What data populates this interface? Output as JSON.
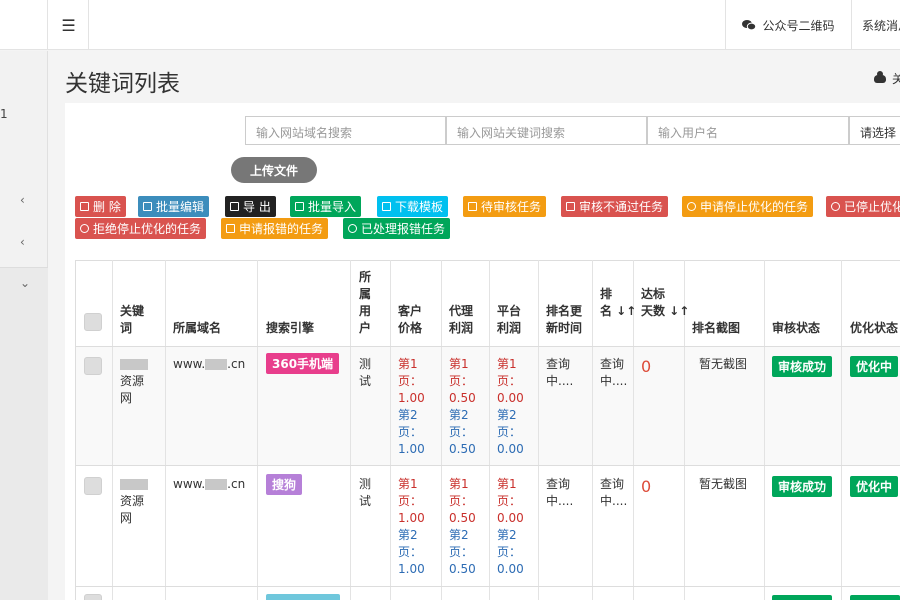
{
  "header": {
    "menu_icon": "menu-icon",
    "wechat_label": "公众号二维码",
    "wechat_icon": "wechat-icon",
    "system_label": "系统消息"
  },
  "sidebar": {
    "item_number": "1"
  },
  "page": {
    "title": "关键词列表",
    "cloud_label": "关"
  },
  "search": {
    "domain_placeholder": "输入网站域名搜索",
    "keyword_placeholder": "输入网站关键词搜索",
    "user_placeholder": "输入用户名",
    "select_placeholder": "请选择"
  },
  "upload_label": "上传文件",
  "actions": [
    {
      "label": "删 除",
      "color": "#d9534f"
    },
    {
      "label": "批量编辑",
      "color": "#3c8dbc"
    },
    {
      "label": "导 出",
      "color": "#222222"
    },
    {
      "label": "批量导入",
      "color": "#00a65a"
    },
    {
      "label": "下载模板",
      "color": "#00c0ef"
    },
    {
      "label": "待审核任务",
      "color": "#f39c12"
    },
    {
      "label": "审核不通过任务",
      "color": "#d9534f"
    },
    {
      "label": "申请停止优化的任务",
      "color": "#f39c12"
    },
    {
      "label": "已停止优化",
      "color": "#d9534f"
    },
    {
      "label": "拒绝停止优化的任务",
      "color": "#d9534f"
    },
    {
      "label": "申请报错的任务",
      "color": "#f39c12"
    },
    {
      "label": "已处理报错任务",
      "color": "#00a65a"
    }
  ],
  "table": {
    "headers": {
      "keyword": [
        "关键",
        "词"
      ],
      "domain": "所属域名",
      "engine": "搜索引擎",
      "user": [
        "所",
        "属",
        "用",
        "户"
      ],
      "client_price": [
        "客户",
        "价格"
      ],
      "agent_profit": [
        "代理",
        "利润"
      ],
      "platform_profit": [
        "平台",
        "利润"
      ],
      "rank_time": [
        "排名更",
        "新时间"
      ],
      "rank": [
        "排",
        "名 ↓↑"
      ],
      "days": [
        "达标",
        "天数 ↓↑"
      ],
      "screenshot": "排名截图",
      "review": "审核状态",
      "optimize": "优化状态"
    },
    "rows": [
      {
        "keyword": [
          "资源",
          "网"
        ],
        "domain_prefix": "www.",
        "domain_suffix": ".cn",
        "engine": "360手机端",
        "user": [
          "测",
          "试"
        ],
        "client": [
          "第1",
          "页：",
          "1.00",
          "第2",
          "页：",
          "1.00"
        ],
        "agent": [
          "第1",
          "页：",
          "0.50",
          "第2",
          "页：",
          "0.50"
        ],
        "platform": [
          "第1",
          "页：",
          "0.00",
          "第2",
          "页：",
          "0.00"
        ],
        "rank_time": [
          "查询",
          "中...."
        ],
        "rank": [
          "查询",
          "中...."
        ],
        "days": "0",
        "screenshot": "暂无截图",
        "review": "审核成功",
        "optimize": "优化中"
      },
      {
        "keyword": [
          "资源",
          "网"
        ],
        "domain_prefix": "www.",
        "domain_suffix": ".cn",
        "engine": "搜狗",
        "user": [
          "测",
          "试"
        ],
        "client": [
          "第1",
          "页：",
          "1.00",
          "第2",
          "页：",
          "1.00"
        ],
        "agent": [
          "第1",
          "页：",
          "0.50",
          "第2",
          "页：",
          "0.50"
        ],
        "platform": [
          "第1",
          "页：",
          "0.00",
          "第2",
          "页：",
          "0.00"
        ],
        "rank_time": [
          "查询",
          "中...."
        ],
        "rank": [
          "查询",
          "中...."
        ],
        "days": "0",
        "screenshot": "暂无截图",
        "review": "审核成功",
        "optimize": "优化中"
      }
    ]
  }
}
